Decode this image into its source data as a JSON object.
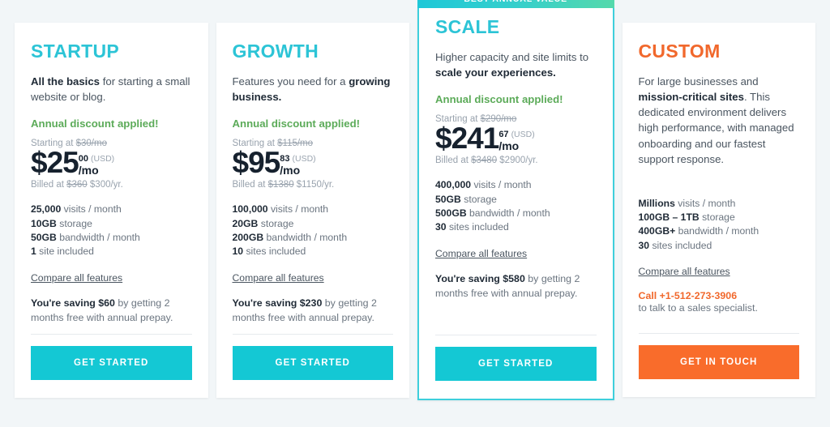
{
  "background": "#f2f6f8",
  "colors": {
    "teal": "#14c8d4",
    "title_teal": "#2cc4d6",
    "orange": "#f96c2b",
    "title_orange": "#f1682c",
    "green": "#5cab59",
    "dark": "#16212e"
  },
  "plans": [
    {
      "id": "startup",
      "name": "STARTUP",
      "tagline_bold": "All the basics",
      "tagline_rest": " for starting a small website or blog.",
      "discount_note": "Annual discount applied!",
      "starting_prefix": "Starting at ",
      "starting_struck": "$30/mo",
      "price_dollars": "$25",
      "price_cents": "00",
      "price_currency": "(USD)",
      "price_period": "/mo",
      "billed_prefix": "Billed at ",
      "billed_struck": "$360",
      "billed_now": " $300/yr.",
      "features": [
        {
          "value": "25,000",
          "label": " visits / month"
        },
        {
          "value": "10GB",
          "label": " storage"
        },
        {
          "value": "50GB",
          "label": " bandwidth / month"
        },
        {
          "value": "1",
          "label": " site included"
        }
      ],
      "compare_label": "Compare all features",
      "saving_bold": "You're saving $60",
      "saving_rest": " by getting 2 months free with annual prepay.",
      "cta_label": "GET STARTED",
      "cta_style": "teal",
      "featured": false,
      "ribbon": ""
    },
    {
      "id": "growth",
      "name": "GROWTH",
      "tagline_bold": "",
      "tagline_rest": "Features you need for a ",
      "tagline_bold2": "growing business.",
      "discount_note": "Annual discount applied!",
      "starting_prefix": "Starting at ",
      "starting_struck": "$115/mo",
      "price_dollars": "$95",
      "price_cents": "83",
      "price_currency": "(USD)",
      "price_period": "/mo",
      "billed_prefix": "Billed at ",
      "billed_struck": "$1380",
      "billed_now": " $1150/yr.",
      "features": [
        {
          "value": "100,000",
          "label": " visits / month"
        },
        {
          "value": "20GB",
          "label": " storage"
        },
        {
          "value": "200GB",
          "label": " bandwidth / month"
        },
        {
          "value": "10",
          "label": " sites included"
        }
      ],
      "compare_label": "Compare all features",
      "saving_bold": "You're saving $230",
      "saving_rest": " by getting 2 months free with annual prepay.",
      "cta_label": "GET STARTED",
      "cta_style": "teal",
      "featured": false,
      "ribbon": ""
    },
    {
      "id": "scale",
      "name": "SCALE",
      "tagline_bold": "",
      "tagline_rest": "Higher capacity and site limits to ",
      "tagline_bold2": "scale your experiences.",
      "discount_note": "Annual discount applied!",
      "starting_prefix": "Starting at ",
      "starting_struck": "$290/mo",
      "price_dollars": "$241",
      "price_cents": "67",
      "price_currency": "(USD)",
      "price_period": "/mo",
      "billed_prefix": "Billed at ",
      "billed_struck": "$3480",
      "billed_now": " $2900/yr.",
      "features": [
        {
          "value": "400,000",
          "label": " visits / month"
        },
        {
          "value": "50GB",
          "label": " storage"
        },
        {
          "value": "500GB",
          "label": " bandwidth / month"
        },
        {
          "value": "30",
          "label": " sites included"
        }
      ],
      "compare_label": "Compare all features",
      "saving_bold": "You're saving $580",
      "saving_rest": " by getting 2 months free with annual prepay.",
      "cta_label": "GET STARTED",
      "cta_style": "teal",
      "featured": true,
      "ribbon": "BEST ANNUAL VALUE"
    },
    {
      "id": "custom",
      "name": "CUSTOM",
      "tagline_bold": "",
      "tagline_rest": "For large businesses and ",
      "tagline_bold2": "mission-critical sites",
      "tagline_tail": ". This dedicated environment delivers high performance, with managed onboarding and our fastest support response.",
      "features": [
        {
          "value": "Millions",
          "label": " visits / month"
        },
        {
          "value": "100GB – 1TB",
          "label": " storage"
        },
        {
          "value": "400GB+",
          "label": " bandwidth / month"
        },
        {
          "value": "30",
          "label": " sites included"
        }
      ],
      "compare_label": "Compare all features",
      "call_label": "Call +1-512-273-3906",
      "call_sub": "to talk to a sales specialist.",
      "cta_label": "GET IN TOUCH",
      "cta_style": "orange",
      "featured": false,
      "ribbon": ""
    }
  ]
}
